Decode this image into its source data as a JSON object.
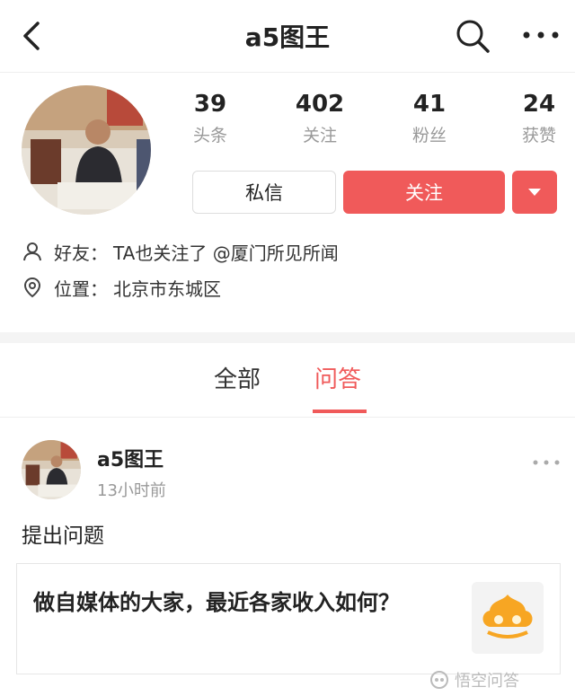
{
  "header": {
    "title": "a5图王"
  },
  "profile": {
    "stats": [
      {
        "num": "39",
        "label": "头条"
      },
      {
        "num": "402",
        "label": "关注"
      },
      {
        "num": "41",
        "label": "粉丝"
      },
      {
        "num": "24",
        "label": "获赞"
      }
    ],
    "message_label": "私信",
    "follow_label": "关注",
    "friend_label": "好友：",
    "friend_value": "TA也关注了 @厦门所见所闻",
    "location_label": "位置：",
    "location_value": "北京市东城区"
  },
  "tabs": [
    {
      "label": "全部",
      "active": false
    },
    {
      "label": "问答",
      "active": true
    }
  ],
  "post": {
    "author": "a5图王",
    "time": "13小时前",
    "action": "提出问题",
    "question": "做自媒体的大家，最近各家收入如何？"
  },
  "watermark": {
    "text": "悟空问答"
  },
  "colors": {
    "accent": "#f05a5a"
  }
}
